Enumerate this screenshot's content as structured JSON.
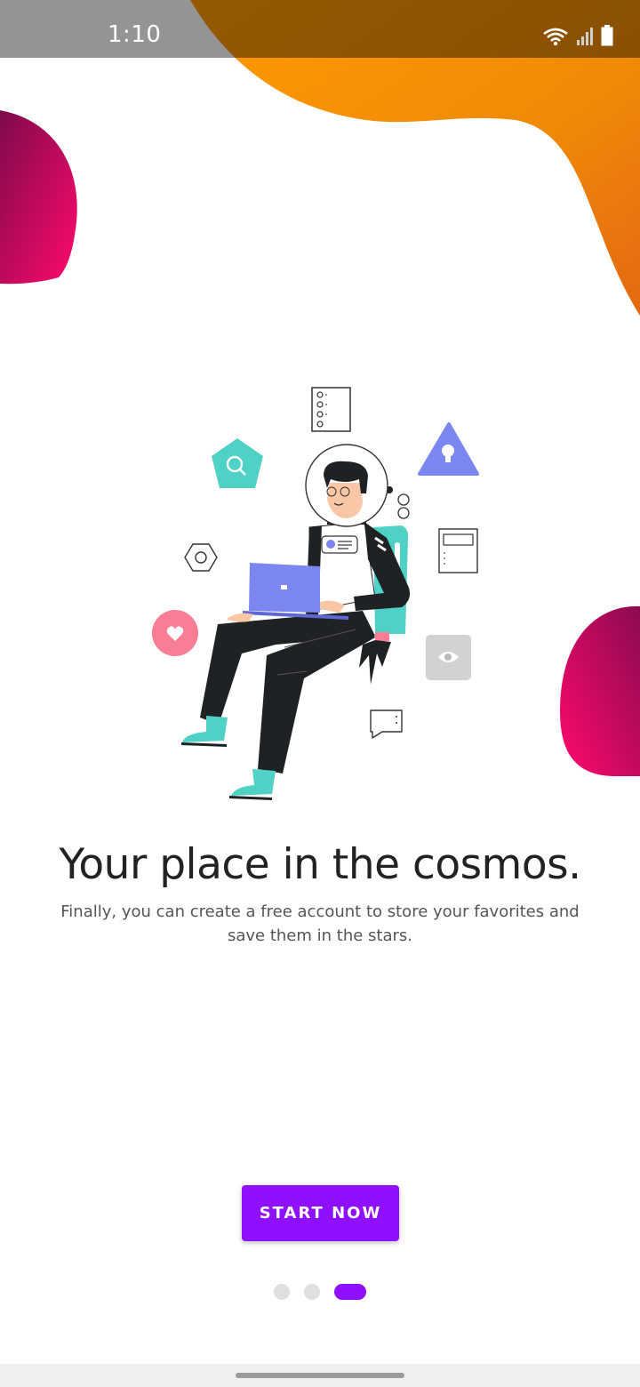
{
  "status_bar": {
    "time": "1:10"
  },
  "onboarding": {
    "title": "Your place in the cosmos.",
    "subtitle": "Finally, you can create a free account to store your favorites and save them in the stars.",
    "start_label": "START NOW"
  },
  "pager": {
    "total_pages": 3,
    "active_page": 3
  },
  "colors": {
    "accent": "#8e10ff",
    "blob_orange": "#f7930a",
    "blob_magenta": "#ff0a6c",
    "teal": "#4fd1c5",
    "periwinkle": "#7b86f0",
    "pink": "#f77e94"
  },
  "icons": [
    "wifi-icon",
    "signal-icon",
    "battery-icon",
    "search-icon",
    "lightbulb-icon",
    "heart-icon",
    "eye-icon",
    "checklist-icon",
    "chat-bubble-icon",
    "hexagon-icon",
    "document-icon"
  ]
}
